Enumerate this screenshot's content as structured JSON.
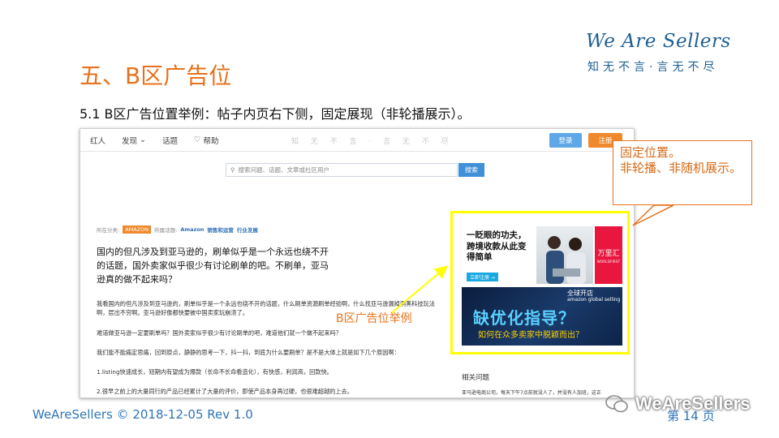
{
  "slide": {
    "title": "五、B区广告位",
    "subtitle": "5.1  B区广告位置举例：帖子内页右下侧，固定展现（非轮播展示）。",
    "brand_name": "We Are Sellers",
    "brand_slogan": "知无不言·言无不尽",
    "footer": "WeAreSellers © 2018-12-05  Rev 1.0",
    "page_label": "第 14 页",
    "watermark": "WeAreSellers",
    "accent_color": "#e8711b",
    "brand_color": "#1f5f94"
  },
  "screenshot": {
    "nav": {
      "items": [
        "红人",
        "发现",
        "话题",
        "帮助"
      ],
      "center_text": "知 无 不 言 · 言 无 不 尽",
      "login": "登录",
      "register": "注册"
    },
    "search": {
      "placeholder": "搜索问题、话题、文章或社区用户",
      "button": "搜索"
    },
    "tags": {
      "category_label": "所在分类:",
      "category": "AMAZON",
      "topic_label": "所属话题:",
      "topics": [
        "Amazon",
        "销售和运营",
        "行业发展"
      ]
    },
    "article": {
      "title": "国内的但凡涉及到亚马逊的，刷单似乎是一个永远也绕不开的话题，国外卖家似乎很少有讨论刷单的吧。不刷单，亚马逊真的做不起来吗？",
      "paragraphs": [
        "我看国内的但凡涉及到亚马逊的，刷单似乎是一个永远也绕不开的话题，什么刷单资源刷单经验啊，什么找亚马逊漏掉洞黑科技玩法啊，层出不穷啊。亚马逊好像都快要被中国卖家玩崩溃了。",
        "难道做亚马逊一定要刷单吗？国外卖家似乎很少有讨论刷单的吧，难道他们就一个做不起来吗？",
        "我们能不能痛定思痛，回到原点，静静的思考一下，抖一抖，到底为什么要刷单？是不是大体上就是如下几个原因啊：",
        "1.listing快速成长，短期内有望成为爆款（长命不长命看造化），有快感，利润高，回款快。",
        "2.很早之前上的大量同行的产品已经累计了大量的评价，即使产品本身再过硬，也很难超越的上去。"
      ]
    },
    "sidebar": {
      "title": "相关问题",
      "line": "亚马逊电商公司，每天下午7点前就没人了，并没有人加班，这正"
    },
    "ads": {
      "ad1_text": "一眨眼的功夫，跨境收款从此变得简单",
      "ad1_button": "立即注册 →",
      "ad1_brand": "万里汇",
      "ad1_brand_sub": "WORLDFIRST",
      "ad2_top": "全球开店",
      "ad2_logo": "amazon global selling",
      "ad2_main": "缺优化指导？",
      "ad2_sub": "如何在众多卖家中脱颖而出？"
    }
  },
  "callouts": {
    "position_note": "固定位置。\n非轮播、非随机展示。",
    "ad_example": "B区广告位举例"
  }
}
